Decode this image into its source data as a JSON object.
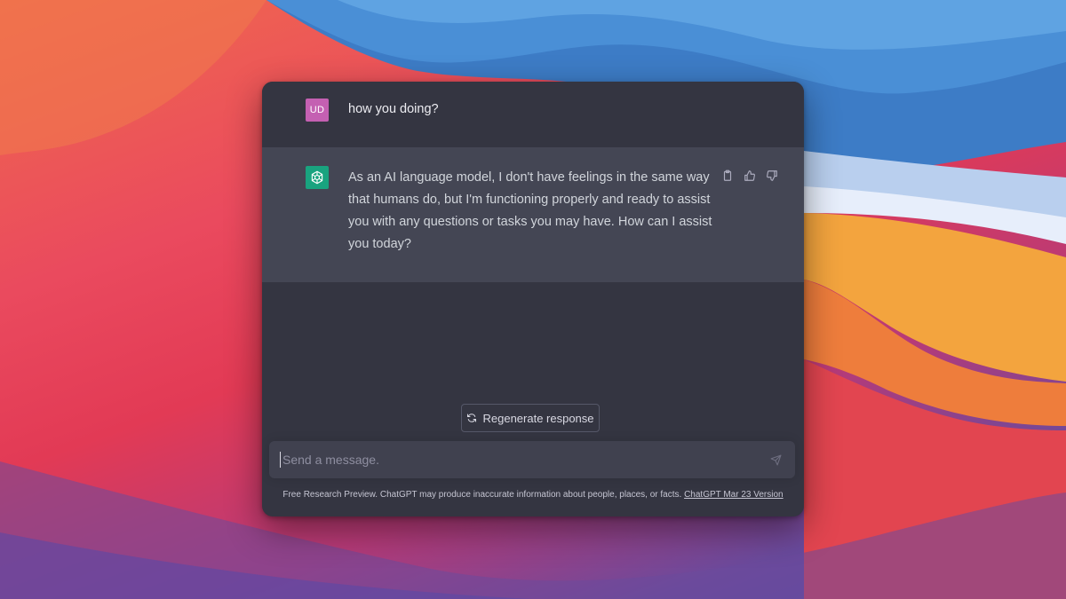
{
  "conversation": {
    "user_message": {
      "avatar_initials": "UD",
      "text": "how you doing?"
    },
    "assistant_message": {
      "avatar_icon": "openai-logo-icon",
      "text": "As an AI language model, I don't have feelings in the same way that humans do, but I'm functioning properly and ready to assist you with any questions or tasks you may have. How can I assist you today?",
      "actions": [
        "copy-icon",
        "thumbs-up-icon",
        "thumbs-down-icon"
      ]
    }
  },
  "regenerate_label": "Regenerate response",
  "composer": {
    "placeholder": "Send a message."
  },
  "footer": {
    "text": "Free Research Preview. ChatGPT may produce inaccurate information about people, places, or facts.",
    "link_text": "ChatGPT Mar 23 Version"
  },
  "colors": {
    "window_bg": "#343541",
    "assistant_row_bg": "#444654",
    "input_bg": "#40414f",
    "user_avatar": "#c460b2",
    "bot_avatar": "#19a37f"
  }
}
